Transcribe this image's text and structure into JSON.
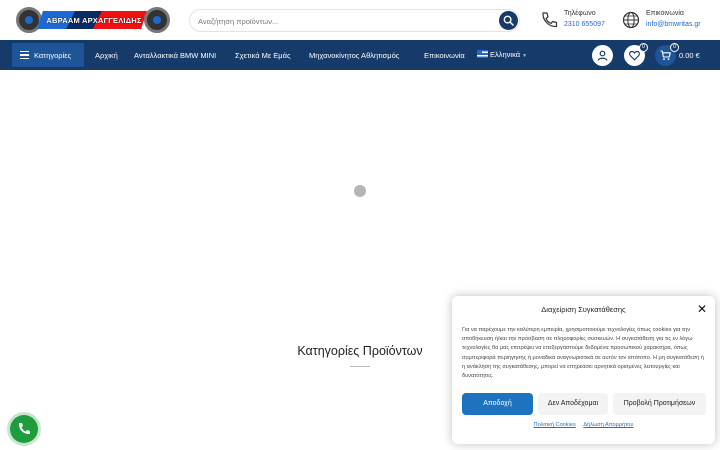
{
  "header": {
    "logo_text": "ΑΒΡΑΑΜ ΑΡΧΑΓΓΕΛΙΔΗΣ",
    "search_placeholder": "Αναζήτηση προϊόντων...",
    "phone": {
      "label": "Τηλέφωνο",
      "value": "2310 655097",
      "icon": "phone-icon"
    },
    "email": {
      "label": "Επικοινωνία",
      "value": "info@bmwritas.gr",
      "icon": "globe-icon"
    }
  },
  "nav": {
    "categories_label": "Κατηγορίες",
    "items": [
      "Αρχική",
      "Ανταλλακτικά BMW MINI",
      "Σχετικά Με Εμάς",
      "Μηχανοκίνητος Αθλητισμός",
      "Επικοινωνία"
    ],
    "language": "Ελληνικά",
    "wishlist_count": "0",
    "cart_count": "0",
    "cart_total": "0.00 €"
  },
  "main": {
    "section_title": "Κατηγορίες Προϊόντων"
  },
  "cookie": {
    "title": "Διαχείριση Συγκατάθεσης",
    "body": "Για να παρέχουμε την καλύτερη εμπειρία, χρησιμοποιούμε τεχνολογίες όπως cookies για την αποθήκευση ή/και την πρόσβαση σε πληροφορίες συσκευών. Η συγκατάθεση για τις εν λόγω τεχνολογίες θα μας επιτρέψει να επεξεργαστούμε δεδομένα προσωπικού χαρακτήρα, όπως συμπεριφορά περιήγησης ή μοναδικά αναγνωριστικά σε αυτόν τον ιστότοπο. Η μη συγκατάθεση ή η ανάκληση της συγκατάθεσης, μπορεί να επηρεάσει αρνητικά ορισμένες λειτουργίες και δυνατότητες.",
    "accept_label": "Αποδοχή",
    "deny_label": "Δεν Αποδέχομαι",
    "prefs_label": "Προβολή Προτιμήσεων",
    "cookie_policy_link": "Πολιτική Cookies",
    "privacy_link": "Δήλωση Απορρήτου"
  },
  "colors": {
    "nav_bg": "#163b6b",
    "category_btn": "#1d5598",
    "accent_blue": "#1e73be",
    "phone_fab": "#1f9d3c"
  }
}
